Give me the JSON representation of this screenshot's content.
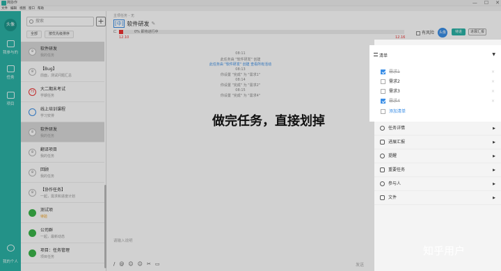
{
  "window": {
    "app_name": "简协作"
  },
  "menu": [
    "文件",
    "编辑",
    "视图",
    "窗口",
    "帮助"
  ],
  "window_controls": [
    "—",
    "☐",
    "✕"
  ],
  "leftnav": {
    "avatar": "头像",
    "items": [
      {
        "label": "我参与的"
      },
      {
        "label": "任务"
      },
      {
        "label": "项目"
      }
    ],
    "bottom_label": "我的个人"
  },
  "list_panel": {
    "search_placeholder": "搜索",
    "add_label": "+",
    "chips": [
      "全部",
      "按优先级排序"
    ],
    "tasks": [
      {
        "title": "软件研发",
        "sub": "我的任务",
        "badge": "8",
        "badge_style": "gray"
      },
      {
        "title": "【Bug】",
        "sub": "前面，测试问题汇总",
        "badge": "8",
        "badge_style": "gray"
      },
      {
        "title": "大二期末考试",
        "sub": "学期任务",
        "badge": "75",
        "badge_style": "red"
      },
      {
        "title": "线上培训课程",
        "sub": "学习安排",
        "badge": "",
        "badge_style": "blue"
      },
      {
        "title": "软件研发",
        "sub": "我的任务",
        "badge": "8",
        "badge_style": "gray"
      },
      {
        "title": "翻译项目",
        "sub": "我的任务",
        "badge": "8",
        "badge_style": "gray"
      },
      {
        "title": "回顾",
        "sub": "我的任务",
        "badge": "8",
        "badge_style": "gray"
      },
      {
        "title": "【协作任务】",
        "sub": "一起，需求和进度计划",
        "badge": "8",
        "badge_style": "gray"
      },
      {
        "title": "测试项",
        "sub": "待验",
        "badge": "",
        "badge_style": "green",
        "sub_orange": true
      },
      {
        "title": "公司群",
        "sub": "一起，最新动态",
        "badge": "",
        "badge_style": "green"
      },
      {
        "title": "项目：任务管理",
        "sub": "项目任务",
        "badge": "",
        "badge_style": "green"
      }
    ]
  },
  "detail": {
    "path": "主项任务 - 无",
    "priority": "[中]",
    "title": "软件研发",
    "edit_icon": "✎",
    "progress_percent": 0,
    "progress_text": "0%  即将进行中",
    "start_date": "12.10",
    "end_date": "12.16",
    "risk_label": "有风险",
    "assignee": "头像",
    "status": "待进",
    "report_btn": "进展汇报",
    "feed": [
      {
        "text": "08:11",
        "link": false
      },
      {
        "text": "此任务由 \"软件研发\" 创建",
        "link": false
      },
      {
        "text": "此任务由 \"软件研发\" 创建  查看所有活动",
        "link": true
      },
      {
        "text": "08:13",
        "link": false
      },
      {
        "text": "你设置 \"完成\" 为 \"需求1\"",
        "link": false
      },
      {
        "text": "08:14",
        "link": false
      },
      {
        "text": "你设置 \"完成\" 为 \"需求2\"",
        "link": false
      },
      {
        "text": "08:15",
        "link": false
      },
      {
        "text": "你设置 \"完成\" 为 \"需求4\"",
        "link": false
      }
    ],
    "comment_placeholder": "请输入说明",
    "toolbar_icons": [
      "/",
      "@",
      "☺",
      "☺",
      "✂",
      "▭"
    ],
    "send_label": "发送"
  },
  "right_panel": {
    "checklist": {
      "title": "清单",
      "items": [
        {
          "label": "需求1",
          "checked": true
        },
        {
          "label": "需求2",
          "checked": false
        },
        {
          "label": "需求3",
          "checked": false
        },
        {
          "label": "需求4",
          "checked": true
        }
      ],
      "add_label": "添加清单"
    },
    "sections": [
      "任务详情",
      "进展汇报",
      "提醒",
      "重要任务",
      "参与人",
      "文件"
    ]
  },
  "caption": "做完任务，直接划掉",
  "watermark": "知乎用户",
  "colors": {
    "teal": "#2bb3a6",
    "blue": "#3a8ee6",
    "red": "#e33333"
  }
}
